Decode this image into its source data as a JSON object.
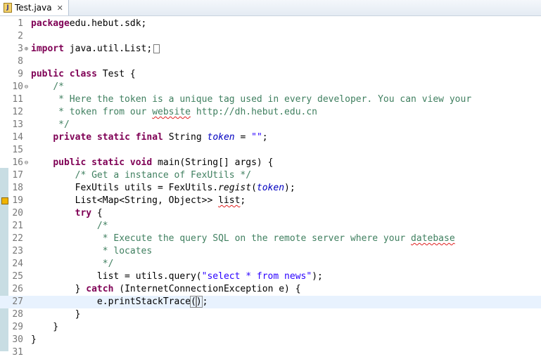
{
  "tab": {
    "title": "Test.java",
    "close_glyph": "✕",
    "icon_glyph": "J"
  },
  "code_lines": [
    {
      "n": "1",
      "tokens": [
        [
          "kw",
          "package"
        ],
        [
          "",
          "edu.hebut.sdk;"
        ]
      ]
    },
    {
      "n": "2",
      "tokens": []
    },
    {
      "n": "3",
      "fold": "⊕",
      "collapsed": true,
      "tokens": [
        [
          "kw",
          "import"
        ],
        [
          "",
          " java.util.List;"
        ]
      ]
    },
    {
      "n": "8",
      "tokens": []
    },
    {
      "n": "9",
      "tokens": [
        [
          "kw",
          "public"
        ],
        [
          "",
          " "
        ],
        [
          "kw",
          "class"
        ],
        [
          "",
          " Test {"
        ]
      ]
    },
    {
      "n": "10",
      "fold": "⊖",
      "tokens": [
        [
          "",
          "    "
        ],
        [
          "cm",
          "/*"
        ]
      ]
    },
    {
      "n": "11",
      "tokens": [
        [
          "",
          "     "
        ],
        [
          "cm",
          "* Here the token is a unique tag used in every developer. You can view your"
        ]
      ]
    },
    {
      "n": "12",
      "tokens": [
        [
          "",
          "     "
        ],
        [
          "cm",
          "* token from our "
        ],
        [
          "cm sq",
          "website"
        ],
        [
          "cm",
          " http://dh.hebut.edu.cn"
        ]
      ]
    },
    {
      "n": "13",
      "tokens": [
        [
          "",
          "     "
        ],
        [
          "cm",
          "*/"
        ]
      ]
    },
    {
      "n": "14",
      "tokens": [
        [
          "",
          "    "
        ],
        [
          "kw",
          "private"
        ],
        [
          "",
          " "
        ],
        [
          "kw",
          "static"
        ],
        [
          "",
          " "
        ],
        [
          "kw",
          "final"
        ],
        [
          "",
          " String "
        ],
        [
          "fld",
          "token"
        ],
        [
          "",
          " = "
        ],
        [
          "str",
          "\"\""
        ],
        [
          "",
          ";"
        ]
      ]
    },
    {
      "n": "15",
      "tokens": []
    },
    {
      "n": "16",
      "fold": "⊖",
      "tokens": [
        [
          "",
          "    "
        ],
        [
          "kw",
          "public"
        ],
        [
          "",
          " "
        ],
        [
          "kw",
          "static"
        ],
        [
          "",
          " "
        ],
        [
          "kw",
          "void"
        ],
        [
          "",
          " main(String[] args) {"
        ]
      ]
    },
    {
      "n": "17",
      "tokens": [
        [
          "",
          "        "
        ],
        [
          "cm",
          "/* Get a instance of FexUtils */"
        ]
      ]
    },
    {
      "n": "18",
      "tokens": [
        [
          "",
          "        FexUtils utils = FexUtils."
        ],
        [
          "it",
          "regist"
        ],
        [
          "",
          "("
        ],
        [
          "fld",
          "token"
        ],
        [
          "",
          ");"
        ]
      ]
    },
    {
      "n": "19",
      "warn": true,
      "tokens": [
        [
          "",
          "        List<Map<String, Object>> "
        ],
        [
          "sq",
          "list"
        ],
        [
          "",
          ";"
        ]
      ]
    },
    {
      "n": "20",
      "tokens": [
        [
          "",
          "        "
        ],
        [
          "kw",
          "try"
        ],
        [
          "",
          " {"
        ]
      ]
    },
    {
      "n": "21",
      "tokens": [
        [
          "",
          "            "
        ],
        [
          "cm",
          "/*"
        ]
      ]
    },
    {
      "n": "22",
      "tokens": [
        [
          "",
          "             "
        ],
        [
          "cm",
          "* Execute the query SQL on the remote server where your "
        ],
        [
          "cm sq",
          "datebase"
        ]
      ]
    },
    {
      "n": "23",
      "tokens": [
        [
          "",
          "             "
        ],
        [
          "cm",
          "* locates"
        ]
      ]
    },
    {
      "n": "24",
      "tokens": [
        [
          "",
          "             "
        ],
        [
          "cm",
          "*/"
        ]
      ]
    },
    {
      "n": "25",
      "tokens": [
        [
          "",
          "            list = utils.query("
        ],
        [
          "str",
          "\"select * from news\""
        ],
        [
          "",
          ");"
        ]
      ]
    },
    {
      "n": "26",
      "tokens": [
        [
          "",
          "        } "
        ],
        [
          "kw",
          "catch"
        ],
        [
          "",
          " (InternetConnectionException e) {"
        ]
      ]
    },
    {
      "n": "27",
      "current": true,
      "tokens": [
        [
          "",
          "            e.printStackTrace"
        ],
        [
          "box",
          "("
        ],
        [
          "box",
          ")"
        ],
        [
          "caret",
          ";"
        ]
      ]
    },
    {
      "n": "28",
      "tokens": [
        [
          "",
          "        }"
        ]
      ]
    },
    {
      "n": "29",
      "tokens": [
        [
          "",
          "    }"
        ]
      ]
    },
    {
      "n": "30",
      "tokens": [
        [
          "",
          "}"
        ]
      ]
    },
    {
      "n": "31",
      "tokens": []
    }
  ]
}
